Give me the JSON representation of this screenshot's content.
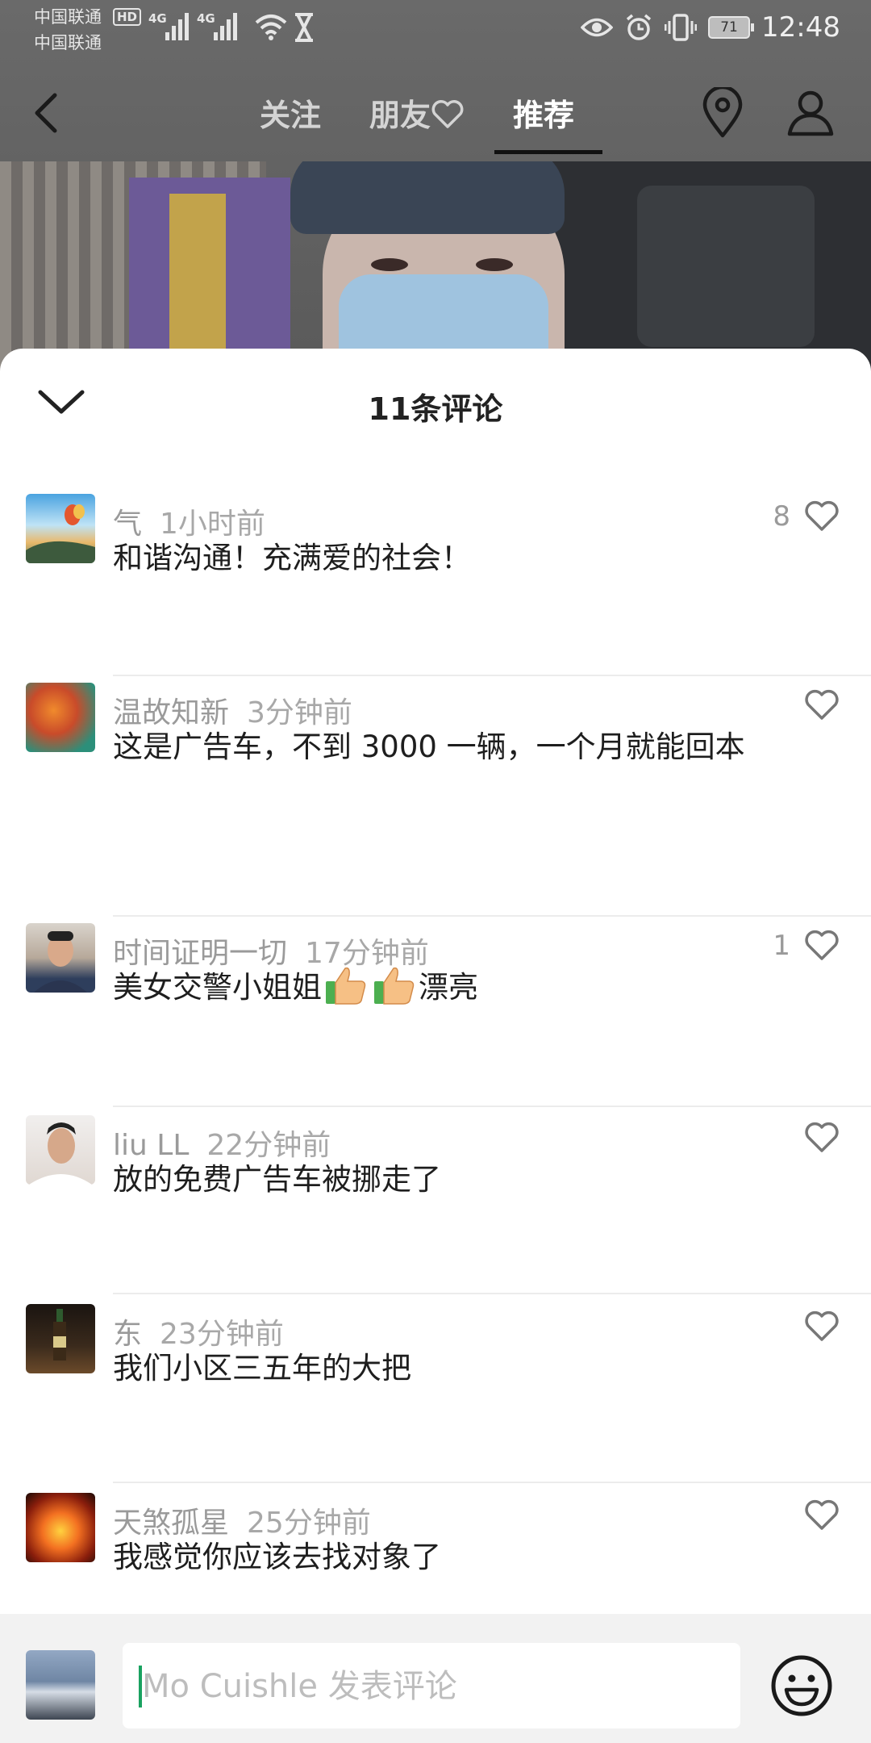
{
  "status_bar": {
    "carrier_1": "中国联通",
    "carrier_2": "中国联通",
    "hd": "HD",
    "net_1": "4G",
    "net_2": "4G",
    "battery": "71",
    "time": "12:48"
  },
  "nav": {
    "tabs": [
      "关注",
      "朋友",
      "推荐"
    ],
    "active_tab": "推荐"
  },
  "sheet": {
    "title": "11条评论"
  },
  "comments": [
    {
      "user": "气",
      "time": "1小时前",
      "text": "和谐沟通！充满爱的社会！",
      "likes": "8"
    },
    {
      "user": "温故知新",
      "time": "3分钟前",
      "text": "这是广告车，不到 3000 一辆，一个月就能回本",
      "likes": ""
    },
    {
      "user": "时间证明一切",
      "time": "17分钟前",
      "text_before": "美女交警小姐姐",
      "text_after": "漂亮",
      "likes": "1"
    },
    {
      "user": "liu LL",
      "time": "22分钟前",
      "text": "放的免费广告车被挪走了",
      "likes": ""
    },
    {
      "user": "东",
      "time": "23分钟前",
      "text": "我们小区三五年的大把",
      "likes": ""
    },
    {
      "user": "天煞孤星",
      "time": "25分钟前",
      "text": "我感觉你应该去找对象了",
      "likes": ""
    }
  ],
  "input": {
    "placeholder": "Mo Cuishle 发表评论"
  },
  "colors": {
    "accent_caret": "#1aa260",
    "sheet_bg": "#ffffff",
    "muted_text": "#9a9a9a"
  }
}
